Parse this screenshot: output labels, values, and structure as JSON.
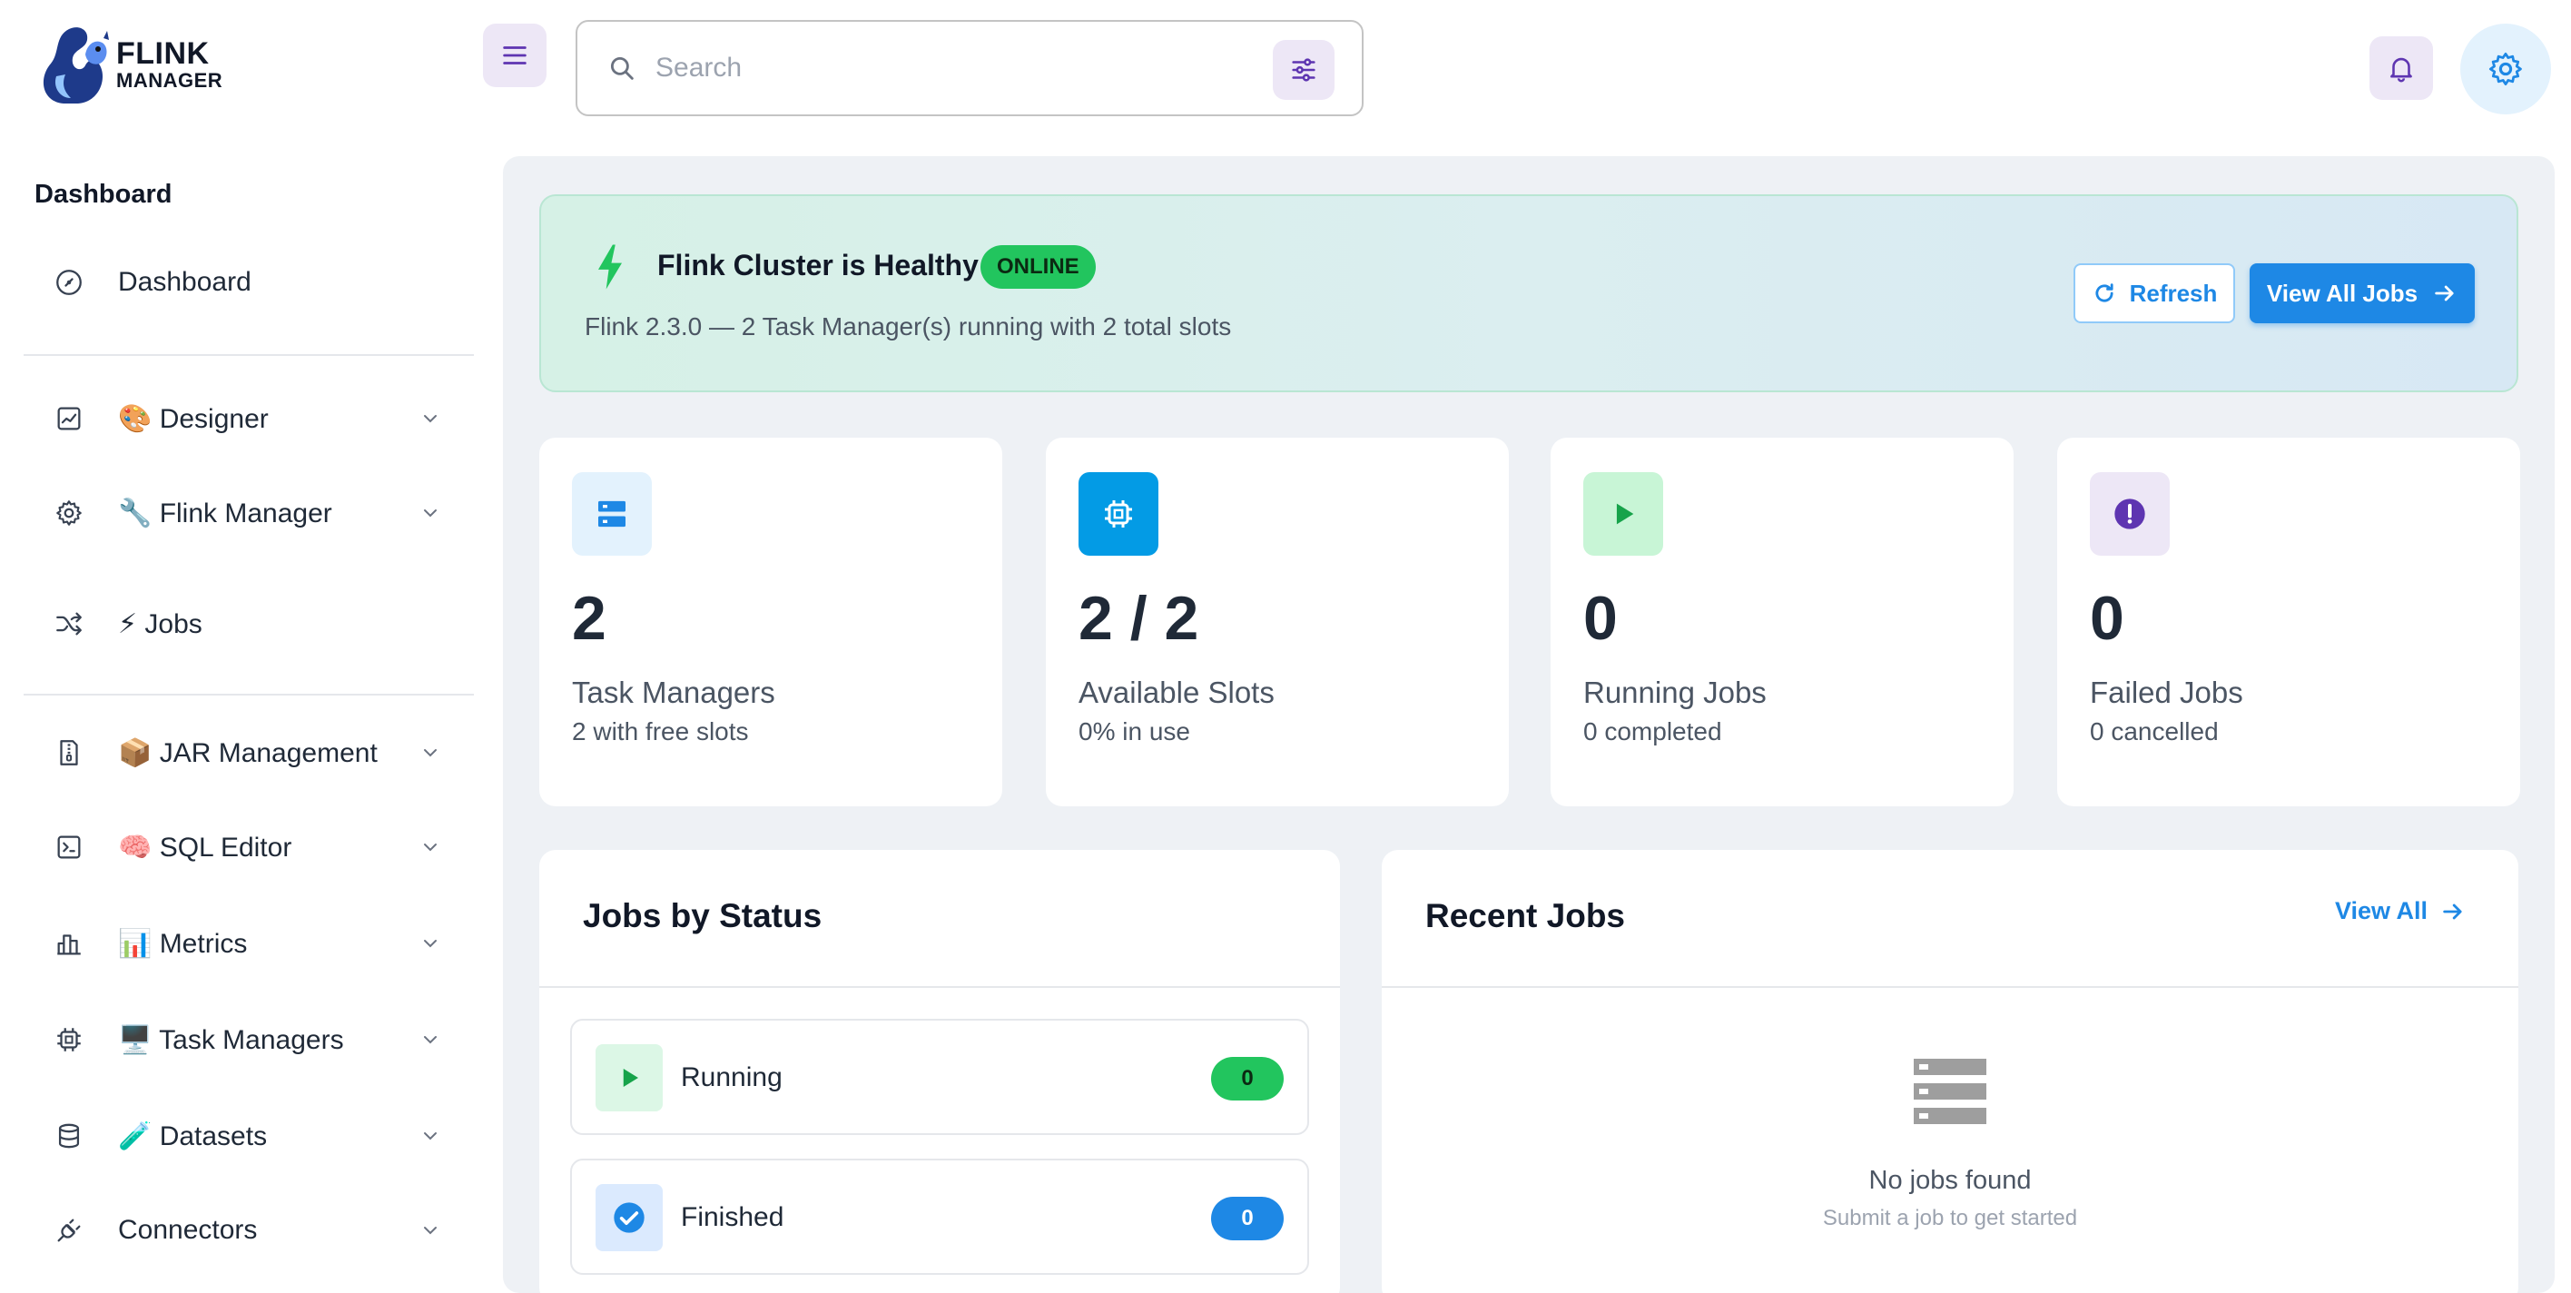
{
  "app": {
    "logo_line1": "FLINK",
    "logo_line2": "MANAGER"
  },
  "search": {
    "placeholder": "Search"
  },
  "sidebar": {
    "heading": "Dashboard",
    "items": [
      {
        "label": "Dashboard",
        "icon": "dashboard-icon"
      },
      {
        "label": "🎨 Designer",
        "icon": "chart-icon",
        "expandable": true
      },
      {
        "label": "🔧 Flink Manager",
        "icon": "gear-icon",
        "expandable": true
      },
      {
        "label": "⚡ Jobs",
        "icon": "shuffle-icon"
      },
      {
        "label": "📦 JAR Management",
        "icon": "zip-file-icon",
        "expandable": true
      },
      {
        "label": "🧠 SQL Editor",
        "icon": "terminal-icon",
        "expandable": true
      },
      {
        "label": "📊 Metrics",
        "icon": "bar-chart-icon",
        "expandable": true
      },
      {
        "label": "🖥️ Task Managers",
        "icon": "chip-icon",
        "expandable": true
      },
      {
        "label": "🧪 Datasets",
        "icon": "database-icon",
        "expandable": true
      },
      {
        "label": "Connectors",
        "icon": "plug-icon",
        "expandable": true
      }
    ]
  },
  "banner": {
    "title": "Flink Cluster is Healthy",
    "badge": "ONLINE",
    "subtitle": "Flink 2.3.0 — 2 Task Manager(s) running with 2 total slots",
    "refresh_label": "Refresh",
    "view_all_label": "View All Jobs"
  },
  "stats": [
    {
      "value": "2",
      "label": "Task Managers",
      "sub": "2 with free slots",
      "icon": "server-icon",
      "color": "#1e88e5"
    },
    {
      "value": "2 / 2",
      "label": "Available Slots",
      "sub": "0% in use",
      "icon": "chip-icon",
      "color": "#039be5"
    },
    {
      "value": "0",
      "label": "Running Jobs",
      "sub": "0 completed",
      "icon": "play-icon",
      "color": "#22c55e"
    },
    {
      "value": "0",
      "label": "Failed Jobs",
      "sub": "0 cancelled",
      "icon": "alert-icon",
      "color": "#5e35b1"
    }
  ],
  "jobs_by_status": {
    "title": "Jobs by Status",
    "rows": [
      {
        "label": "Running",
        "count": "0",
        "color": "#22c55e",
        "icon": "play-icon"
      },
      {
        "label": "Finished",
        "count": "0",
        "color": "#1e88e5",
        "icon": "check-icon"
      }
    ]
  },
  "recent_jobs": {
    "title": "Recent Jobs",
    "view_all": "View All",
    "empty_title": "No jobs found",
    "empty_sub": "Submit a job to get started"
  }
}
